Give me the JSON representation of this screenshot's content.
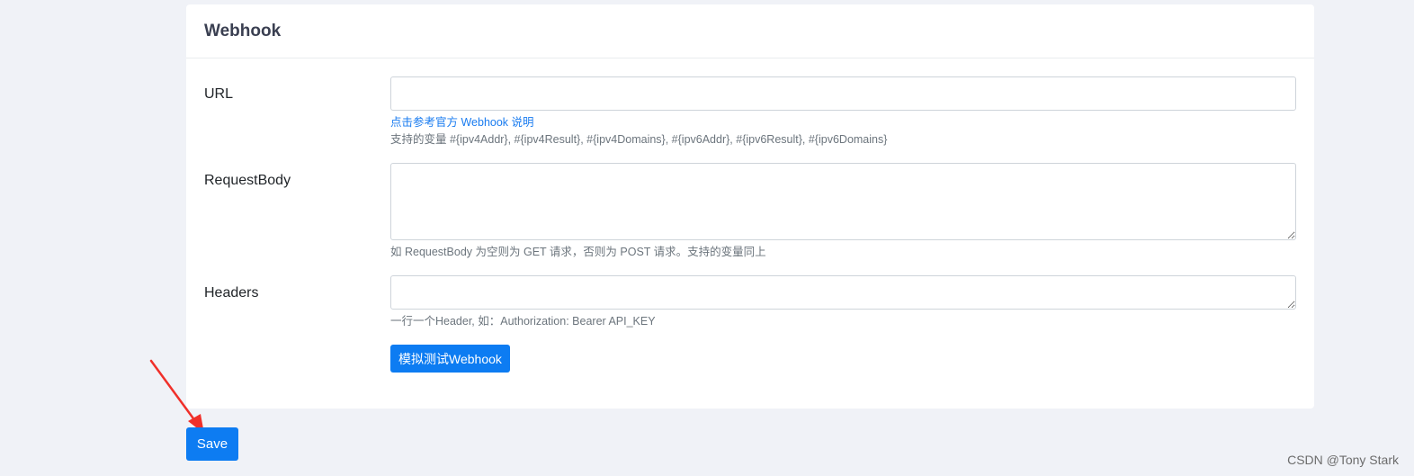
{
  "card": {
    "title": "Webhook"
  },
  "url_field": {
    "label": "URL",
    "value": "",
    "link": "点击参考官方 Webhook 说明",
    "help": "支持的变量 #{ipv4Addr}, #{ipv4Result}, #{ipv4Domains}, #{ipv6Addr}, #{ipv6Result}, #{ipv6Domains}"
  },
  "body_field": {
    "label": "RequestBody",
    "value": "",
    "help": "如 RequestBody 为空则为 GET 请求，否则为 POST 请求。支持的变量同上"
  },
  "headers_field": {
    "label": "Headers",
    "value": "",
    "help": "一行一个Header, 如：Authorization: Bearer API_KEY"
  },
  "test_button": {
    "label": "模拟测试Webhook"
  },
  "save_button": {
    "label": "Save"
  },
  "watermark": "CSDN @Tony Stark",
  "colors": {
    "primary": "#0d7cf2",
    "annotation_arrow": "#f0302a",
    "background": "#f0f2f7"
  }
}
